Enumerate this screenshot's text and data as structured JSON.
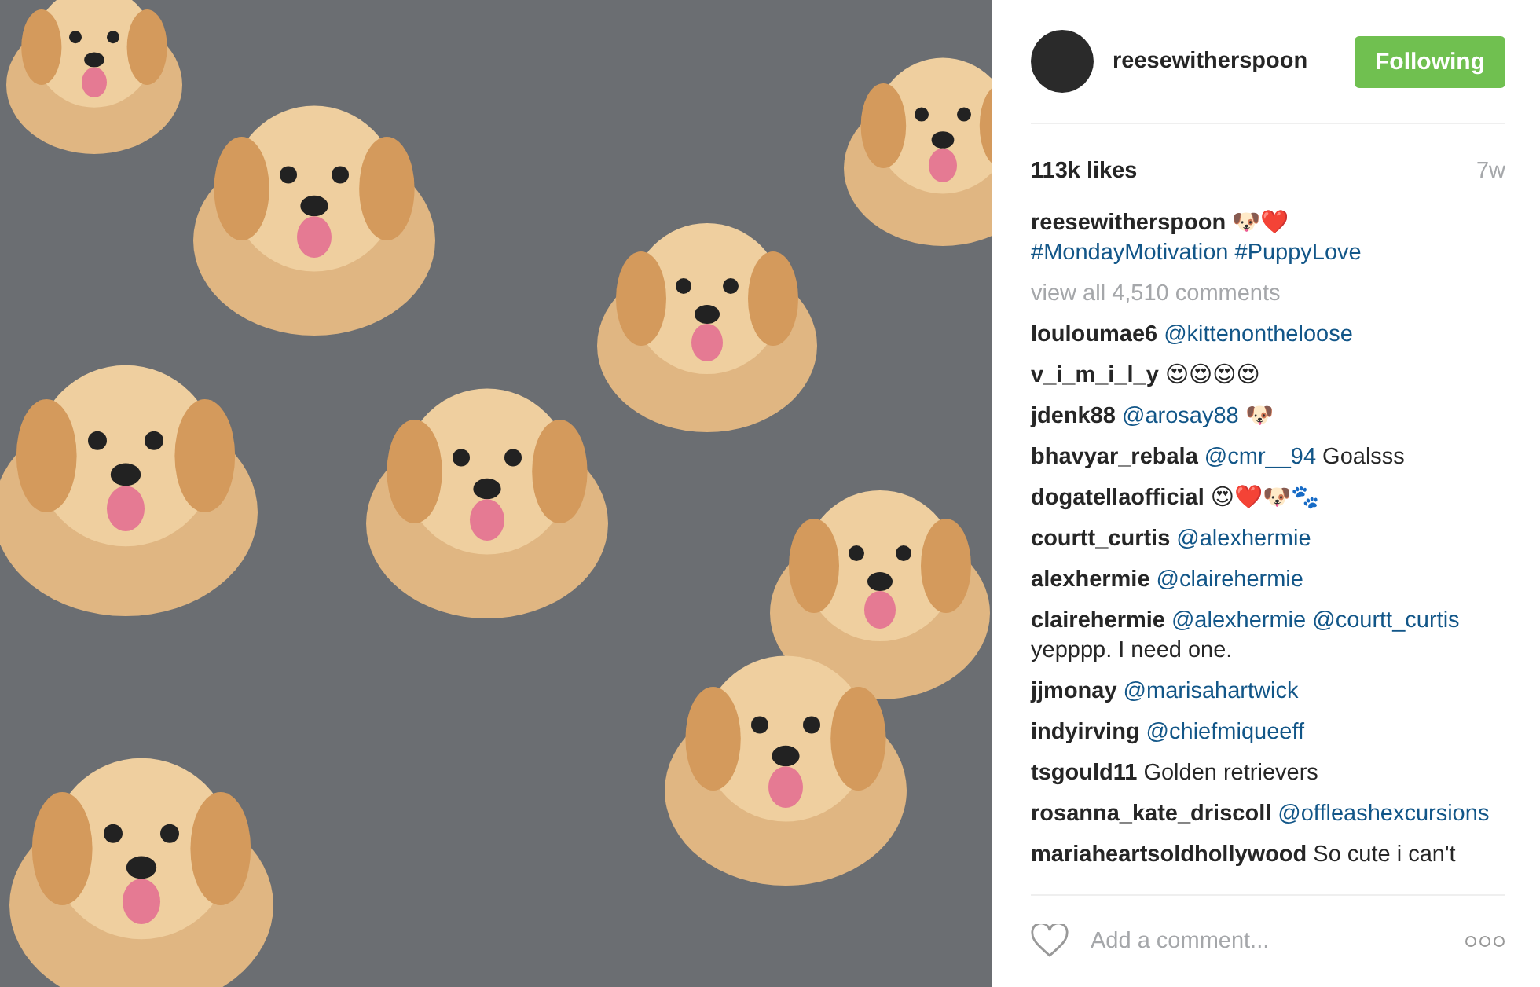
{
  "header": {
    "username": "reesewitherspoon",
    "follow_button": {
      "label": "Following",
      "selected": true
    }
  },
  "likes": "113k likes",
  "age": "7w",
  "caption": {
    "user": "reesewitherspoon",
    "parts": [
      {
        "kind": "text",
        "text": "🐶❤️"
      }
    ],
    "hashtags": [
      "#MondayMotivation",
      "#PuppyLove"
    ]
  },
  "view_all": "view all 4,510 comments",
  "comments": [
    {
      "user": "louloumae6",
      "parts": [
        {
          "kind": "mention",
          "text": "@kittenontheloose"
        }
      ]
    },
    {
      "user": "v_i_m_i_l_y",
      "parts": [
        {
          "kind": "text",
          "text": "😍😍😍😍"
        }
      ]
    },
    {
      "user": "jdenk88",
      "parts": [
        {
          "kind": "mention",
          "text": "@arosay88"
        },
        {
          "kind": "text",
          "text": "🐶"
        }
      ]
    },
    {
      "user": "bhavyar_rebala",
      "parts": [
        {
          "kind": "mention",
          "text": "@cmr__94"
        },
        {
          "kind": "text",
          "text": "Goalsss"
        }
      ]
    },
    {
      "user": "dogatellaofficial",
      "parts": [
        {
          "kind": "text",
          "text": "😍❤️🐶🐾"
        }
      ]
    },
    {
      "user": "courtt_curtis",
      "parts": [
        {
          "kind": "mention",
          "text": "@alexhermie"
        }
      ]
    },
    {
      "user": "alexhermie",
      "parts": [
        {
          "kind": "mention",
          "text": "@clairehermie"
        }
      ]
    },
    {
      "user": "clairehermie",
      "parts": [
        {
          "kind": "mention",
          "text": "@alexhermie"
        },
        {
          "kind": "mention",
          "text": "@courtt_curtis"
        },
        {
          "kind": "text",
          "text": "yepppp. I need one."
        }
      ]
    },
    {
      "user": "jjmonay",
      "parts": [
        {
          "kind": "mention",
          "text": "@marisahartwick"
        }
      ]
    },
    {
      "user": "indyirving",
      "parts": [
        {
          "kind": "mention",
          "text": "@chiefmiqueeff"
        }
      ]
    },
    {
      "user": "tsgould11",
      "parts": [
        {
          "kind": "text",
          "text": "Golden retrievers"
        }
      ]
    },
    {
      "user": "rosanna_kate_driscoll",
      "parts": [
        {
          "kind": "mention",
          "text": "@offleashexcursions"
        }
      ]
    },
    {
      "user": "mariaheartsoldhollywood",
      "parts": [
        {
          "kind": "text",
          "text": "So cute i can't"
        }
      ]
    }
  ],
  "comment_field": {
    "placeholder": "Add a comment..."
  }
}
